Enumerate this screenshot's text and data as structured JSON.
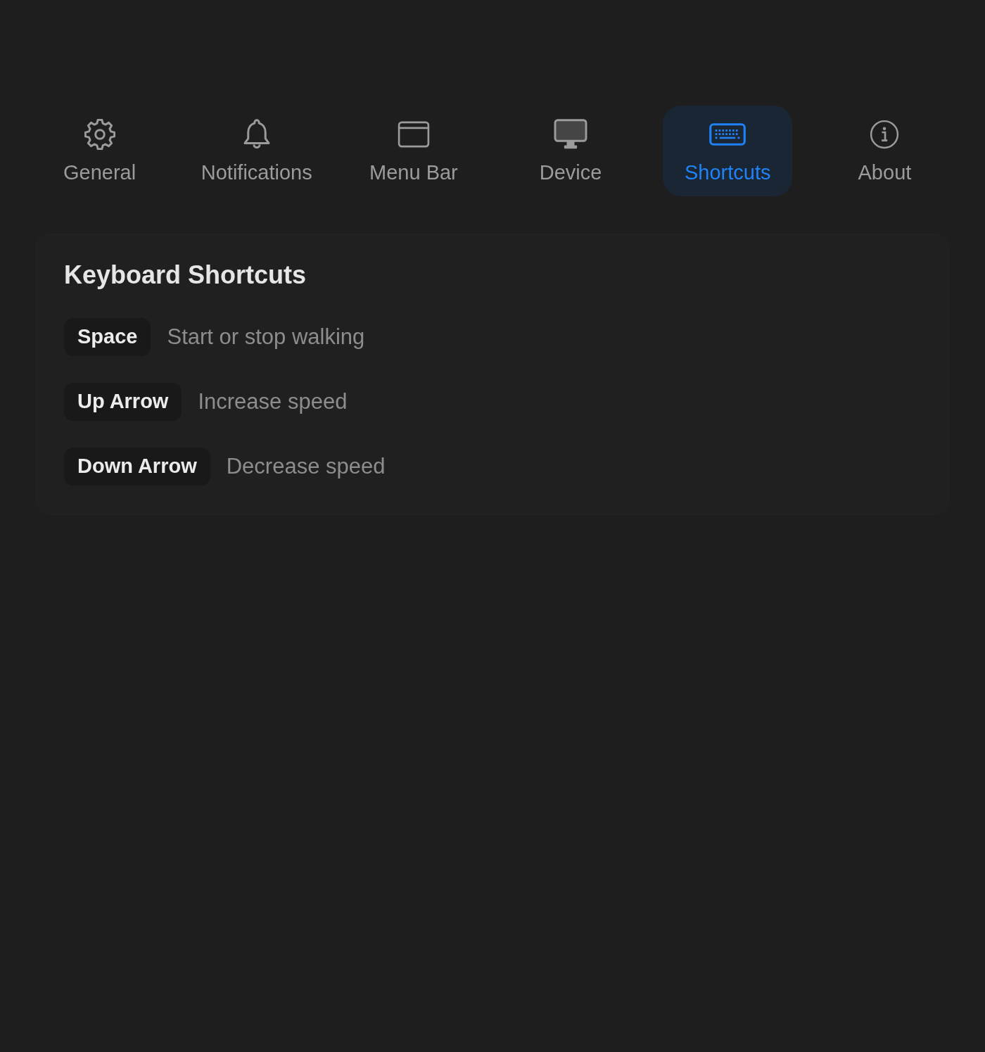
{
  "tabs": [
    {
      "label": "General",
      "kind": "gear",
      "selected": false
    },
    {
      "label": "Notifications",
      "kind": "bell",
      "selected": false
    },
    {
      "label": "Menu Bar",
      "kind": "window",
      "selected": false
    },
    {
      "label": "Device",
      "kind": "monitor",
      "selected": false
    },
    {
      "label": "Shortcuts",
      "kind": "keyboard",
      "selected": true
    },
    {
      "label": "About",
      "kind": "info",
      "selected": false
    }
  ],
  "panel": {
    "title": "Keyboard Shortcuts",
    "shortcuts": [
      {
        "key": "Space",
        "action": "Start or stop walking"
      },
      {
        "key": "Up Arrow",
        "action": "Increase speed"
      },
      {
        "key": "Down Arrow",
        "action": "Decrease speed"
      }
    ]
  }
}
